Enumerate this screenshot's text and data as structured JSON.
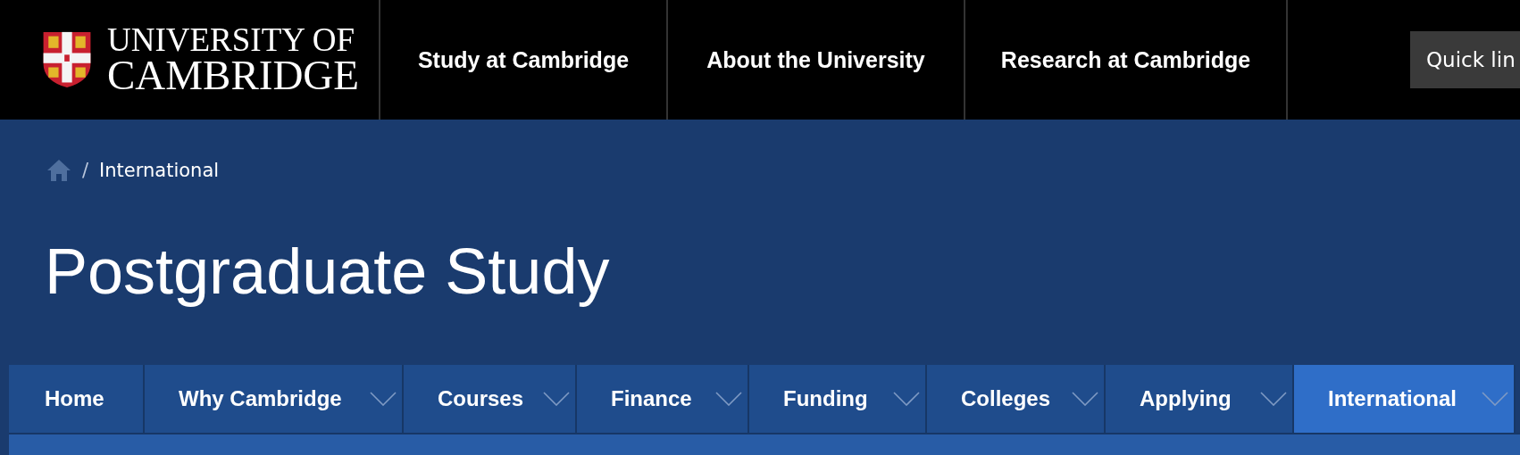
{
  "header": {
    "logo_lines": [
      "UNIVERSITY OF",
      "CAMBRIDGE"
    ],
    "links": [
      "Study at Cambridge",
      "About the University",
      "Research at Cambridge"
    ],
    "quick_links": "Quick lin"
  },
  "breadcrumb": [
    {
      "separator": "/",
      "label": "International"
    }
  ],
  "title": "Postgraduate Study",
  "nav": [
    {
      "label": "Home",
      "dropdown": false,
      "selected": false
    },
    {
      "label": "Why Cambridge",
      "dropdown": true,
      "selected": false
    },
    {
      "label": "Courses",
      "dropdown": true,
      "selected": false
    },
    {
      "label": "Finance",
      "dropdown": true,
      "selected": false
    },
    {
      "label": "Funding",
      "dropdown": true,
      "selected": false
    },
    {
      "label": "Colleges",
      "dropdown": true,
      "selected": false
    },
    {
      "label": "Applying",
      "dropdown": true,
      "selected": false
    },
    {
      "label": "International",
      "dropdown": true,
      "selected": true
    }
  ]
}
